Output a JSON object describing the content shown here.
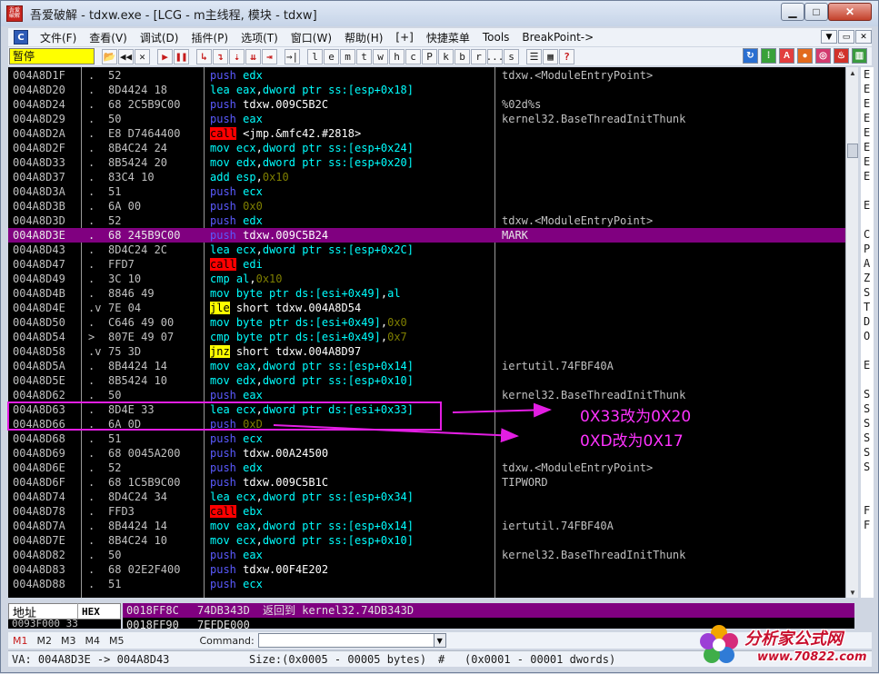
{
  "window": {
    "title": "吾爱破解 - tdxw.exe - [LCG - m主线程, 模块 - tdxw]",
    "app_icon_text": "吾爱破解",
    "min_glyph": "▁",
    "max_glyph": "□",
    "close_glyph": "✕"
  },
  "menubar": {
    "icon": "C",
    "items": [
      "文件(F)",
      "查看(V)",
      "调试(D)",
      "插件(P)",
      "选项(T)",
      "窗口(W)",
      "帮助(H)",
      "[+]",
      "快捷菜单",
      "Tools",
      "BreakPoint->"
    ],
    "mdi_buttons": [
      "▼",
      "▭",
      "✕"
    ]
  },
  "toolbar": {
    "status": "暂停",
    "buttons": [
      {
        "name": "open-icon",
        "glyph": "📂",
        "red": false
      },
      {
        "name": "restart-icon",
        "glyph": "◀◀",
        "red": false
      },
      {
        "name": "close-proc-icon",
        "glyph": "✕",
        "red": false
      },
      {
        "name": "run-icon",
        "glyph": "▶",
        "red": true
      },
      {
        "name": "pause-icon",
        "glyph": "❚❚",
        "red": true
      },
      {
        "name": "step-into-icon",
        "glyph": "↳",
        "red": true
      },
      {
        "name": "step-over-icon",
        "glyph": "↴",
        "red": true
      },
      {
        "name": "trace-into-icon",
        "glyph": "⇣",
        "red": true
      },
      {
        "name": "trace-over-icon",
        "glyph": "⇊",
        "red": true
      },
      {
        "name": "execute-till-return-icon",
        "glyph": "⇥",
        "red": true
      },
      {
        "name": "goto-icon",
        "glyph": "→|",
        "red": false
      }
    ],
    "letters": [
      "l",
      "e",
      "m",
      "t",
      "w",
      "h",
      "c",
      "P",
      "k",
      "b",
      "r",
      "...",
      "s"
    ],
    "extra": [
      "☰",
      "▦",
      "?"
    ],
    "right_icons": [
      {
        "name": "refresh-icon",
        "color": "#2a6fd1",
        "glyph": "↻"
      },
      {
        "name": "grid-icon",
        "color": "#39a13a",
        "glyph": "⁞"
      },
      {
        "name": "a-icon",
        "color": "#e23e3e",
        "glyph": "A"
      },
      {
        "name": "circle-icon",
        "color": "#e26a1e",
        "glyph": "●"
      },
      {
        "name": "target-icon",
        "color": "#d33b6e",
        "glyph": "◎"
      },
      {
        "name": "flame-icon",
        "color": "#d1322a",
        "glyph": "♨"
      },
      {
        "name": "bars-icon",
        "color": "#3a9b3f",
        "glyph": "▥"
      }
    ]
  },
  "disasm": {
    "rows": [
      {
        "addr": "004A8D1F",
        "mark": ".",
        "hex": "52",
        "mn": "push",
        "ops": [
          [
            "edx",
            "reg"
          ]
        ],
        "cmt": "tdxw.<ModuleEntryPoint>",
        "hl": false
      },
      {
        "addr": "004A8D20",
        "mark": ".",
        "hex": "8D4424 18",
        "mn": "lea",
        "ops": [
          [
            "eax",
            "reg"
          ],
          [
            ",",
            "plain"
          ],
          [
            "dword ptr ss:[esp+0x18]",
            "mem"
          ]
        ],
        "cmt": "",
        "hl": false
      },
      {
        "addr": "004A8D24",
        "mark": ".",
        "hex": "68 2C5B9C00",
        "mn": "push",
        "ops": [
          [
            "tdxw.009C5B2C",
            "plain"
          ]
        ],
        "cmt": "%02d%s",
        "hl": false
      },
      {
        "addr": "004A8D29",
        "mark": ".",
        "hex": "50",
        "mn": "push",
        "ops": [
          [
            "eax",
            "reg"
          ]
        ],
        "cmt": "kernel32.BaseThreadInitThunk",
        "hl": false
      },
      {
        "addr": "004A8D2A",
        "mark": ".",
        "hex": "E8 D7464400",
        "mn": "call",
        "ops": [
          [
            "<jmp.&mfc42.#2818>",
            "plain"
          ]
        ],
        "cmt": "",
        "hl": false
      },
      {
        "addr": "004A8D2F",
        "mark": ".",
        "hex": "8B4C24 24",
        "mn": "mov",
        "ops": [
          [
            "ecx",
            "reg"
          ],
          [
            ",",
            "plain"
          ],
          [
            "dword ptr ss:[esp+0x24]",
            "mem"
          ]
        ],
        "cmt": "",
        "hl": false
      },
      {
        "addr": "004A8D33",
        "mark": ".",
        "hex": "8B5424 20",
        "mn": "mov",
        "ops": [
          [
            "edx",
            "reg"
          ],
          [
            ",",
            "plain"
          ],
          [
            "dword ptr ss:[esp+0x20]",
            "mem"
          ]
        ],
        "cmt": "",
        "hl": false
      },
      {
        "addr": "004A8D37",
        "mark": ".",
        "hex": "83C4 10",
        "mn": "add",
        "ops": [
          [
            "esp",
            "reg"
          ],
          [
            ",",
            "plain"
          ],
          [
            "0x10",
            "num"
          ]
        ],
        "cmt": "",
        "hl": false
      },
      {
        "addr": "004A8D3A",
        "mark": ".",
        "hex": "51",
        "mn": "push",
        "ops": [
          [
            "ecx",
            "reg"
          ]
        ],
        "cmt": "",
        "hl": false
      },
      {
        "addr": "004A8D3B",
        "mark": ".",
        "hex": "6A 00",
        "mn": "push",
        "ops": [
          [
            "0x0",
            "num"
          ]
        ],
        "cmt": "",
        "hl": false
      },
      {
        "addr": "004A8D3D",
        "mark": ".",
        "hex": "52",
        "mn": "push",
        "ops": [
          [
            "edx",
            "reg"
          ]
        ],
        "cmt": "tdxw.<ModuleEntryPoint>",
        "hl": false
      },
      {
        "addr": "004A8D3E",
        "mark": ".",
        "hex": "68 245B9C00",
        "mn": "push",
        "ops": [
          [
            "tdxw.009C5B24",
            "plain"
          ]
        ],
        "cmt": "MARK",
        "hl": true
      },
      {
        "addr": "004A8D43",
        "mark": ".",
        "hex": "8D4C24 2C",
        "mn": "lea",
        "ops": [
          [
            "ecx",
            "reg"
          ],
          [
            ",",
            "plain"
          ],
          [
            "dword ptr ss:[esp+0x2C]",
            "mem"
          ]
        ],
        "cmt": "",
        "hl": false
      },
      {
        "addr": "004A8D47",
        "mark": ".",
        "hex": "FFD7",
        "mn": "call",
        "ops": [
          [
            "edi",
            "reg"
          ]
        ],
        "cmt": "",
        "hl": false
      },
      {
        "addr": "004A8D49",
        "mark": ".",
        "hex": "3C 10",
        "mn": "cmp",
        "ops": [
          [
            "al",
            "reg"
          ],
          [
            ",",
            "plain"
          ],
          [
            "0x10",
            "num"
          ]
        ],
        "cmt": "",
        "hl": false
      },
      {
        "addr": "004A8D4B",
        "mark": ".",
        "hex": "8846 49",
        "mn": "mov",
        "ops": [
          [
            "byte ptr ds:[esi+0x49]",
            "mem"
          ],
          [
            ",",
            "plain"
          ],
          [
            "al",
            "reg"
          ]
        ],
        "cmt": "",
        "hl": false
      },
      {
        "addr": "004A8D4E",
        "mark": ".v",
        "hex": "7E 04",
        "mn": "jle",
        "ops": [
          [
            "short tdxw.004A8D54",
            "plain"
          ]
        ],
        "cmt": "",
        "hl": false
      },
      {
        "addr": "004A8D50",
        "mark": ".",
        "hex": "C646 49 00",
        "mn": "mov",
        "ops": [
          [
            "byte ptr ds:[esi+0x49]",
            "mem"
          ],
          [
            ",",
            "plain"
          ],
          [
            "0x0",
            "num"
          ]
        ],
        "cmt": "",
        "hl": false
      },
      {
        "addr": "004A8D54",
        "mark": ">",
        "hex": "807E 49 07",
        "mn": "cmp",
        "ops": [
          [
            "byte ptr ds:[esi+0x49]",
            "mem"
          ],
          [
            ",",
            "plain"
          ],
          [
            "0x7",
            "num"
          ]
        ],
        "cmt": "",
        "hl": false
      },
      {
        "addr": "004A8D58",
        "mark": ".v",
        "hex": "75 3D",
        "mn": "jnz",
        "ops": [
          [
            "short tdxw.004A8D97",
            "plain"
          ]
        ],
        "cmt": "",
        "hl": false
      },
      {
        "addr": "004A8D5A",
        "mark": ".",
        "hex": "8B4424 14",
        "mn": "mov",
        "ops": [
          [
            "eax",
            "reg"
          ],
          [
            ",",
            "plain"
          ],
          [
            "dword ptr ss:[esp+0x14]",
            "mem"
          ]
        ],
        "cmt": "iertutil.74FBF40A",
        "hl": false
      },
      {
        "addr": "004A8D5E",
        "mark": ".",
        "hex": "8B5424 10",
        "mn": "mov",
        "ops": [
          [
            "edx",
            "reg"
          ],
          [
            ",",
            "plain"
          ],
          [
            "dword ptr ss:[esp+0x10]",
            "mem"
          ]
        ],
        "cmt": "",
        "hl": false
      },
      {
        "addr": "004A8D62",
        "mark": ".",
        "hex": "50",
        "mn": "push",
        "ops": [
          [
            "eax",
            "reg"
          ]
        ],
        "cmt": "kernel32.BaseThreadInitThunk",
        "hl": false
      },
      {
        "addr": "004A8D63",
        "mark": ".",
        "hex": "8D4E 33",
        "mn": "lea",
        "ops": [
          [
            "ecx",
            "reg"
          ],
          [
            ",",
            "plain"
          ],
          [
            "dword ptr ds:[esi+0x33]",
            "mem"
          ]
        ],
        "cmt": "",
        "hl": false
      },
      {
        "addr": "004A8D66",
        "mark": ".",
        "hex": "6A 0D",
        "mn": "push",
        "ops": [
          [
            "0xD",
            "num"
          ]
        ],
        "cmt": "",
        "hl": false
      },
      {
        "addr": "004A8D68",
        "mark": ".",
        "hex": "51",
        "mn": "push",
        "ops": [
          [
            "ecx",
            "reg"
          ]
        ],
        "cmt": "",
        "hl": false
      },
      {
        "addr": "004A8D69",
        "mark": ".",
        "hex": "68 0045A200",
        "mn": "push",
        "ops": [
          [
            "tdxw.00A24500",
            "plain"
          ]
        ],
        "cmt": "",
        "hl": false
      },
      {
        "addr": "004A8D6E",
        "mark": ".",
        "hex": "52",
        "mn": "push",
        "ops": [
          [
            "edx",
            "reg"
          ]
        ],
        "cmt": "tdxw.<ModuleEntryPoint>",
        "hl": false
      },
      {
        "addr": "004A8D6F",
        "mark": ".",
        "hex": "68 1C5B9C00",
        "mn": "push",
        "ops": [
          [
            "tdxw.009C5B1C",
            "plain"
          ]
        ],
        "cmt": "TIPWORD",
        "hl": false
      },
      {
        "addr": "004A8D74",
        "mark": ".",
        "hex": "8D4C24 34",
        "mn": "lea",
        "ops": [
          [
            "ecx",
            "reg"
          ],
          [
            ",",
            "plain"
          ],
          [
            "dword ptr ss:[esp+0x34]",
            "mem"
          ]
        ],
        "cmt": "",
        "hl": false
      },
      {
        "addr": "004A8D78",
        "mark": ".",
        "hex": "FFD3",
        "mn": "call",
        "ops": [
          [
            "ebx",
            "reg"
          ]
        ],
        "cmt": "",
        "hl": false
      },
      {
        "addr": "004A8D7A",
        "mark": ".",
        "hex": "8B4424 14",
        "mn": "mov",
        "ops": [
          [
            "eax",
            "reg"
          ],
          [
            ",",
            "plain"
          ],
          [
            "dword ptr ss:[esp+0x14]",
            "mem"
          ]
        ],
        "cmt": "iertutil.74FBF40A",
        "hl": false
      },
      {
        "addr": "004A8D7E",
        "mark": ".",
        "hex": "8B4C24 10",
        "mn": "mov",
        "ops": [
          [
            "ecx",
            "reg"
          ],
          [
            ",",
            "plain"
          ],
          [
            "dword ptr ss:[esp+0x10]",
            "mem"
          ]
        ],
        "cmt": "",
        "hl": false
      },
      {
        "addr": "004A8D82",
        "mark": ".",
        "hex": "50",
        "mn": "push",
        "ops": [
          [
            "eax",
            "reg"
          ]
        ],
        "cmt": "kernel32.BaseThreadInitThunk",
        "hl": false
      },
      {
        "addr": "004A8D83",
        "mark": ".",
        "hex": "68 02E2F400",
        "mn": "push",
        "ops": [
          [
            "tdxw.00F4E202",
            "plain"
          ]
        ],
        "cmt": "",
        "hl": false
      },
      {
        "addr": "004A8D88",
        "mark": ".",
        "hex": "51",
        "mn": "push",
        "ops": [
          [
            "ecx",
            "reg"
          ]
        ],
        "cmt": "",
        "hl": false
      }
    ],
    "right_panel_letters": [
      "E",
      "E",
      "E",
      "E",
      "E",
      "E",
      "E",
      "E",
      "",
      "E",
      "",
      "C",
      "P",
      "A",
      "Z",
      "S",
      "T",
      "D",
      "O",
      "",
      "E",
      "",
      "S",
      "S",
      "S",
      "S",
      "S",
      "S",
      "",
      "",
      "F",
      "F",
      "",
      ""
    ]
  },
  "annotations": {
    "line1": "0X33改为0X20",
    "line2": "0XD改为0X17"
  },
  "dump": {
    "label_addr": "地址",
    "label_hex": "HEX",
    "row2": "0093F000 33"
  },
  "stack": {
    "rows": [
      {
        "addr": "0018FF8C",
        "val": "74DB343D",
        "cmt": "返回到 kernel32.74DB343D",
        "hl": true
      },
      {
        "addr": "0018FF90",
        "val": "7EFDE000",
        "cmt": "",
        "hl": false
      }
    ]
  },
  "cmdbar": {
    "tabs": [
      "M1",
      "M2",
      "M3",
      "M4",
      "M5"
    ],
    "label": "Command:",
    "value": ""
  },
  "statusbar": {
    "va": "VA: 004A8D3E -> 004A8D43",
    "size": "Size:(0x0005 - 00005 bytes)",
    "hash": "#",
    "dwords": "(0x0001 - 00001 dwords)"
  },
  "watermark": {
    "main": "分析家公式网",
    "url": "www.70822.com"
  }
}
